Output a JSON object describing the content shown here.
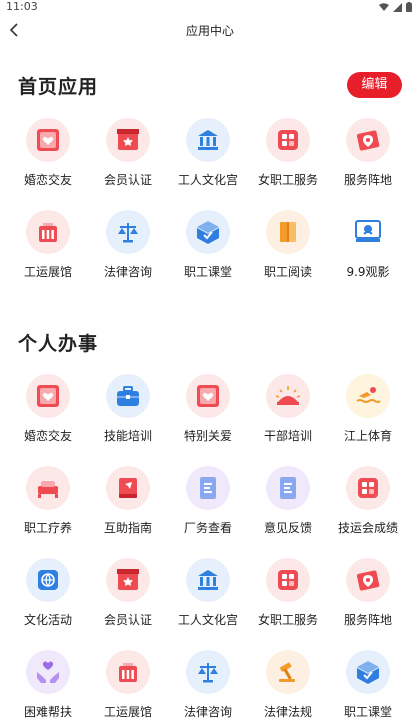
{
  "status": {
    "time": "11:03"
  },
  "header": {
    "title": "应用中心"
  },
  "home_section": {
    "title": "首页应用",
    "edit_label": "编辑",
    "items": [
      {
        "label": "婚恋交友",
        "icon": "heart-card-icon"
      },
      {
        "label": "会员认证",
        "icon": "member-badge-icon"
      },
      {
        "label": "工人文化宫",
        "icon": "palace-icon"
      },
      {
        "label": "女职工服务",
        "icon": "grid-apps-icon"
      },
      {
        "label": "服务阵地",
        "icon": "map-pin-icon"
      },
      {
        "label": "工运展馆",
        "icon": "building-icon"
      },
      {
        "label": "法律咨询",
        "icon": "scales-icon"
      },
      {
        "label": "职工课堂",
        "icon": "class-box-icon"
      },
      {
        "label": "职工阅读",
        "icon": "book-icon"
      },
      {
        "label": "9.9观影",
        "icon": "movie-screen-icon"
      }
    ]
  },
  "personal_section": {
    "title": "个人办事",
    "items": [
      {
        "label": "婚恋交友",
        "icon": "heart-card-icon"
      },
      {
        "label": "技能培训",
        "icon": "briefcase-icon"
      },
      {
        "label": "特别关爱",
        "icon": "heart-card-icon"
      },
      {
        "label": "干部培训",
        "icon": "sunrise-icon"
      },
      {
        "label": "江上体育",
        "icon": "swimmer-icon"
      },
      {
        "label": "职工疗养",
        "icon": "bed-icon"
      },
      {
        "label": "互助指南",
        "icon": "guide-book-icon"
      },
      {
        "label": "厂务查看",
        "icon": "document-icon"
      },
      {
        "label": "意见反馈",
        "icon": "document-icon"
      },
      {
        "label": "技运会成绩",
        "icon": "grid-apps-icon"
      },
      {
        "label": "文化活动",
        "icon": "globe-card-icon"
      },
      {
        "label": "会员认证",
        "icon": "member-badge-icon"
      },
      {
        "label": "工人文化宫",
        "icon": "palace-icon"
      },
      {
        "label": "女职工服务",
        "icon": "grid-apps-icon"
      },
      {
        "label": "服务阵地",
        "icon": "map-pin-icon"
      },
      {
        "label": "困难帮扶",
        "icon": "helping-hands-icon"
      },
      {
        "label": "工运展馆",
        "icon": "building-icon"
      },
      {
        "label": "法律咨询",
        "icon": "scales-icon"
      },
      {
        "label": "法律法规",
        "icon": "gavel-icon"
      },
      {
        "label": "职工课堂",
        "icon": "class-box-icon"
      }
    ]
  },
  "colors": {
    "accent_red": "#e61f2a",
    "icon_red": "#ef4b52",
    "icon_blue": "#2f7fe0",
    "icon_orange": "#f39a2b"
  }
}
